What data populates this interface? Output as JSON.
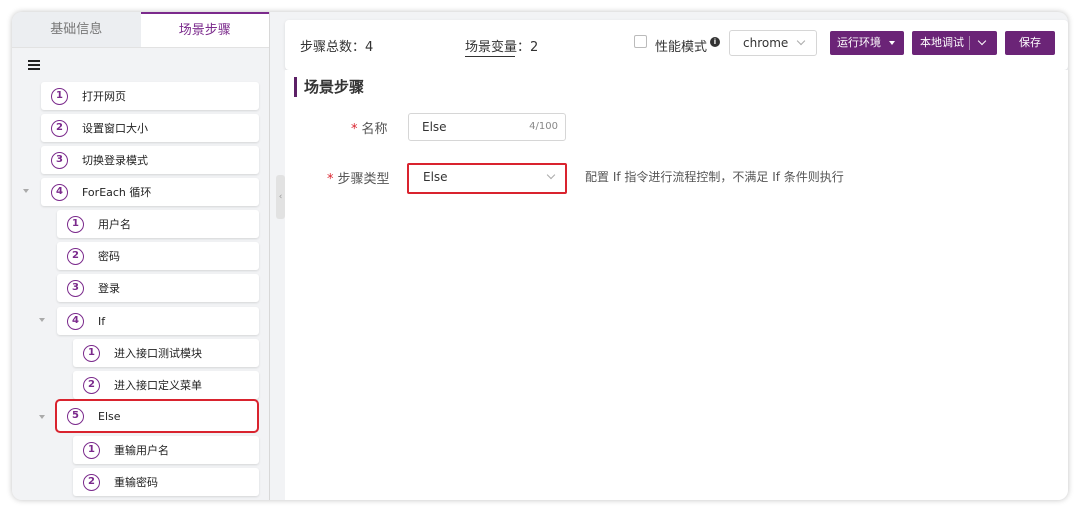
{
  "tabs": {
    "basic": "基础信息",
    "steps": "场景步骤"
  },
  "steps_tree": [
    {
      "num": "1",
      "label": "打开网页"
    },
    {
      "num": "2",
      "label": "设置窗口大小"
    },
    {
      "num": "3",
      "label": "切换登录模式"
    },
    {
      "num": "4",
      "label": "ForEach 循环"
    },
    {
      "num": "1",
      "label": "用户名"
    },
    {
      "num": "2",
      "label": "密码"
    },
    {
      "num": "3",
      "label": "登录"
    },
    {
      "num": "4",
      "label": "If"
    },
    {
      "num": "1",
      "label": "进入接口测试模块"
    },
    {
      "num": "2",
      "label": "进入接口定义菜单"
    },
    {
      "num": "5",
      "label": "Else"
    },
    {
      "num": "1",
      "label": "重输用户名"
    },
    {
      "num": "2",
      "label": "重输密码"
    }
  ],
  "toolbar": {
    "step_total": "步骤总数：4",
    "scene_vars": "场景变量：2",
    "perf_mode": "性能模式",
    "browser": "chrome",
    "run_env": "运行环境",
    "local_debug": "本地调试",
    "save": "保存"
  },
  "form": {
    "section_title": "场景步骤",
    "req_mark": "*",
    "name_label": "名称",
    "name_value": "Else",
    "name_count": "4/100",
    "type_label": "步骤类型",
    "type_value": "Else",
    "hint": "配置 If 指令进行流程控制，不满足 If 条件则执行"
  },
  "colors": {
    "accent": "#6b2477",
    "highlight": "#d9232e"
  }
}
